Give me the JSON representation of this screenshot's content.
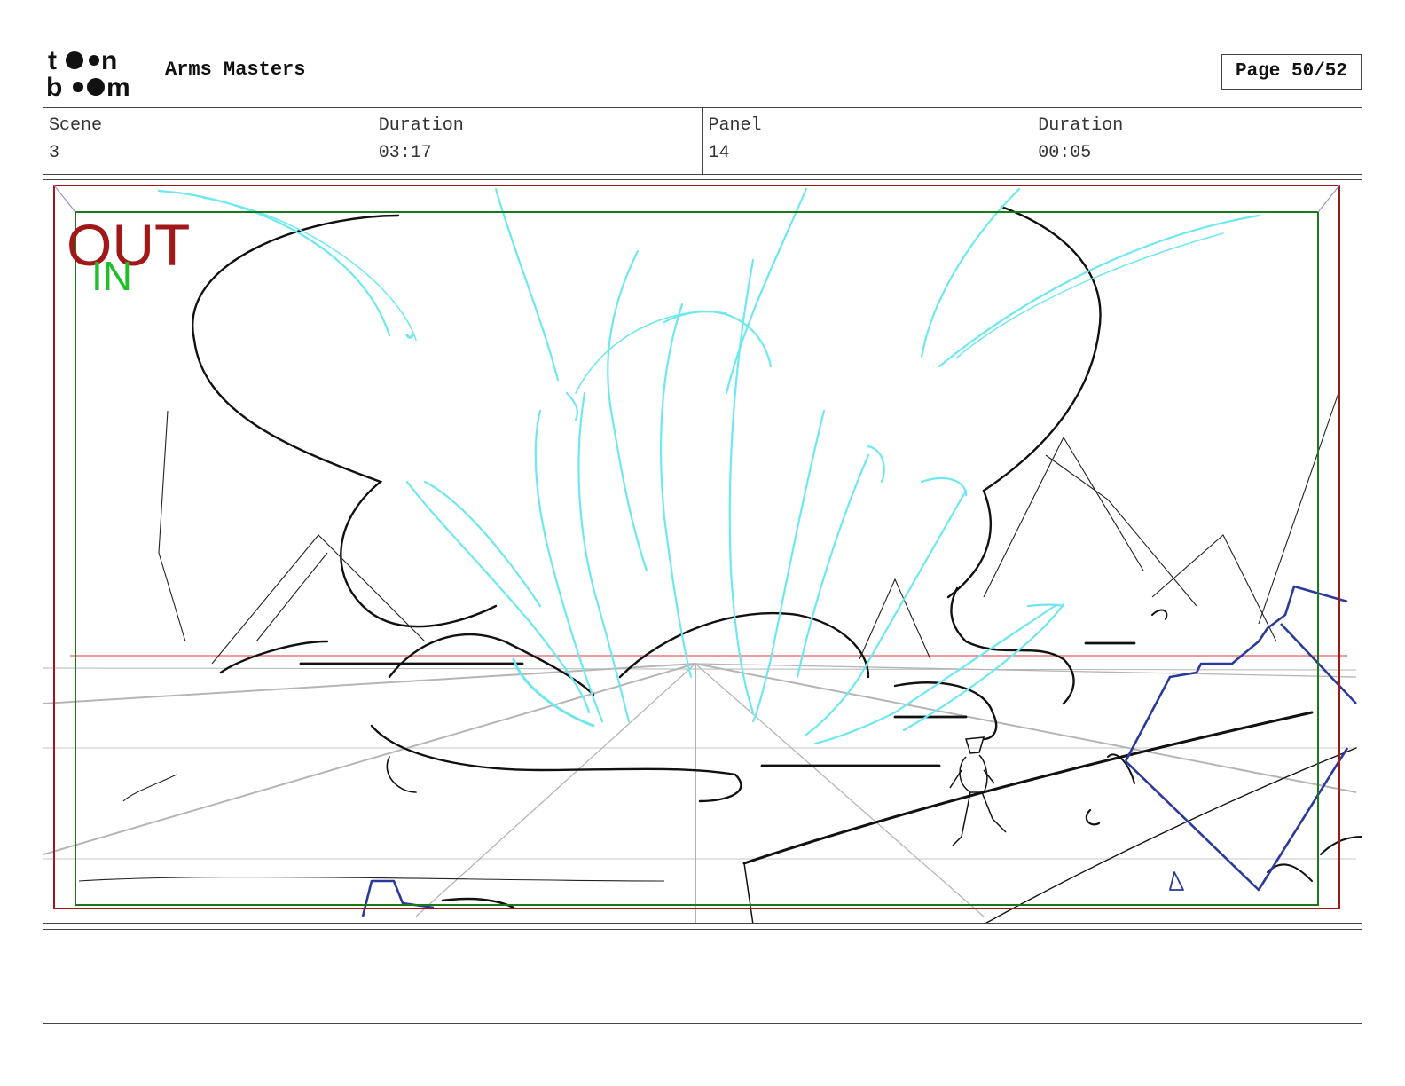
{
  "header": {
    "logo_alt": "toon boom",
    "project_title": "Arms Masters",
    "page_label": "Page 50/52"
  },
  "info": [
    {
      "label": "Scene",
      "value": "3"
    },
    {
      "label": "Duration",
      "value": "03:17"
    },
    {
      "label": "Panel",
      "value": "14"
    },
    {
      "label": "Duration",
      "value": "00:05"
    }
  ],
  "panel": {
    "out_label": "OUT",
    "in_label": "IN",
    "colors": {
      "out_frame": "#a01818",
      "in_frame": "#1a7a1a",
      "effect": "#6ee8f0",
      "sketch": "#111111",
      "perspective": "#b5b5b5",
      "structure": "#2a3a9a",
      "horizon": "#e06060"
    }
  },
  "notes": {
    "text": ""
  }
}
